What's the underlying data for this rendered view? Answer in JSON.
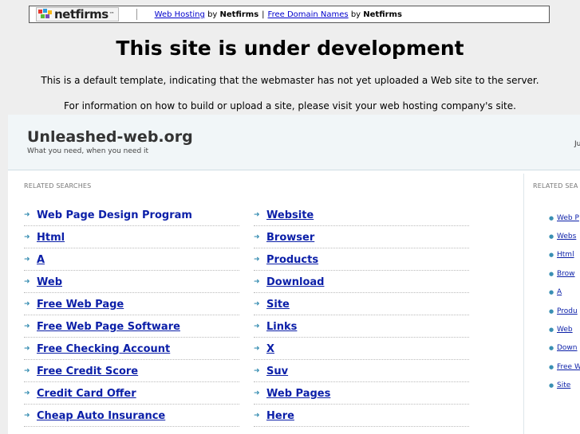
{
  "topbar": {
    "logo_text": "netfirms",
    "logo_tm": "™",
    "hosting_link": "Web Hosting",
    "by1": "by",
    "brand1": "Netfirms",
    "pipe": "|",
    "domain_link": "Free Domain Names",
    "by2": "by",
    "brand2": "Netfirms"
  },
  "headline": "This site is under development",
  "message1": "This is a default template, indicating that the webmaster has not yet uploaded a Web site to the server.",
  "message2": "For information on how to build or upload a site, please visit your web hosting company's site.",
  "frame": {
    "site_title": "Unleashed-web.org",
    "tagline": "What you need, when you need it",
    "header_right": "Ju",
    "related_label": "RELATED SEARCHES",
    "related_label_right": "RELATED SEA",
    "left_links": [
      "Web Page Design Program",
      "Html",
      "A",
      "Web",
      "Free Web Page",
      "Free Web Page Software",
      "Free Checking Account",
      "Free Credit Score",
      "Credit Card Offer",
      "Cheap Auto Insurance"
    ],
    "mid_links": [
      "Website",
      "Browser",
      "Products",
      "Download",
      "Site",
      "Links",
      "X",
      "Suv",
      "Web Pages",
      "Here"
    ],
    "right_links": [
      "Web P",
      "Webs",
      "Html",
      "Brow",
      "A",
      "Produ",
      "Web",
      "Down",
      "Free W",
      "Site"
    ]
  },
  "colors": {
    "link": "#0b1fa8",
    "arrow": "#3a8fb3",
    "header_bg": "#f1f6f8",
    "page_bg": "#eeeeee"
  }
}
